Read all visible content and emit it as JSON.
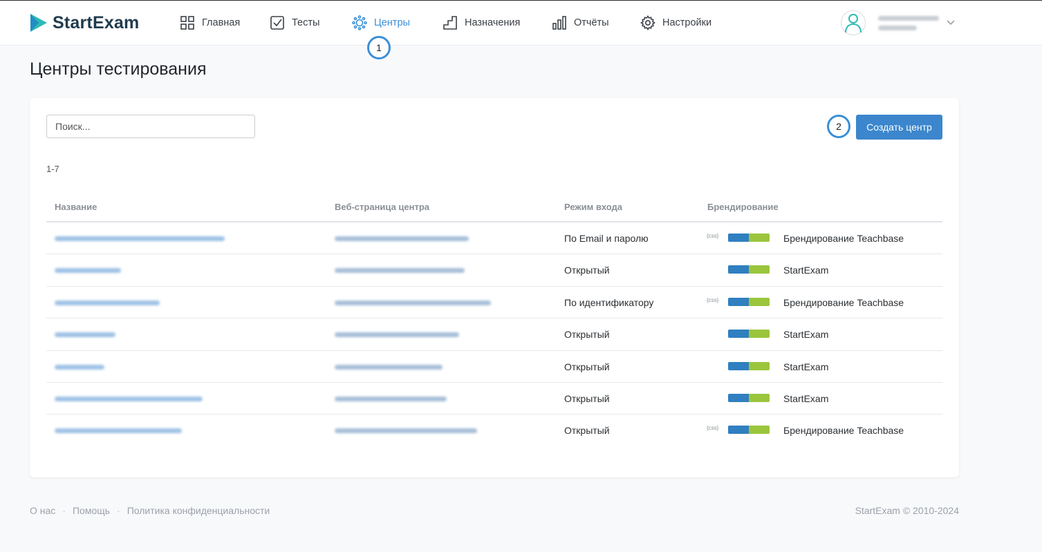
{
  "app": {
    "name": "StartExam"
  },
  "nav": {
    "items": [
      {
        "label": "Главная",
        "icon": "grid-icon"
      },
      {
        "label": "Тесты",
        "icon": "checkbox-icon"
      },
      {
        "label": "Центры",
        "icon": "centers-icon",
        "active": true
      },
      {
        "label": "Назначения",
        "icon": "stairs-icon"
      },
      {
        "label": "Отчёты",
        "icon": "bar-chart-icon"
      },
      {
        "label": "Настройки",
        "icon": "gear-icon"
      }
    ]
  },
  "callouts": {
    "one": "1",
    "two": "2"
  },
  "page": {
    "title": "Центры тестирования"
  },
  "toolbar": {
    "search_placeholder": "Поиск...",
    "create_label": "Создать центр"
  },
  "list": {
    "range": "1-7"
  },
  "table": {
    "headers": {
      "name": "Название",
      "url": "Веб-страница центра",
      "mode": "Режим входа",
      "branding": "Брендирование"
    },
    "rows": [
      {
        "mode": "По Email и паролю",
        "css": "{css}",
        "branding": "Брендирование Teachbase"
      },
      {
        "mode": "Открытый",
        "css": "",
        "branding": "StartExam"
      },
      {
        "mode": "По идентификатору",
        "css": "{css}",
        "branding": "Брендирование Teachbase"
      },
      {
        "mode": "Открытый",
        "css": "",
        "branding": "StartExam"
      },
      {
        "mode": "Открытый",
        "css": "",
        "branding": "StartExam"
      },
      {
        "mode": "Открытый",
        "css": "",
        "branding": "StartExam"
      },
      {
        "mode": "Открытый",
        "css": "{css}",
        "branding": "Брендирование Teachbase"
      }
    ]
  },
  "footer": {
    "about": "О нас",
    "help": "Помощь",
    "privacy": "Политика конфиденциальности",
    "copyright": "StartExam © 2010-2024",
    "separator": "·"
  },
  "colors": {
    "accent": "#3a8fd6",
    "button": "#3b86cc",
    "brand_blue": "#2f7fc1",
    "brand_green": "#9bc53d"
  }
}
